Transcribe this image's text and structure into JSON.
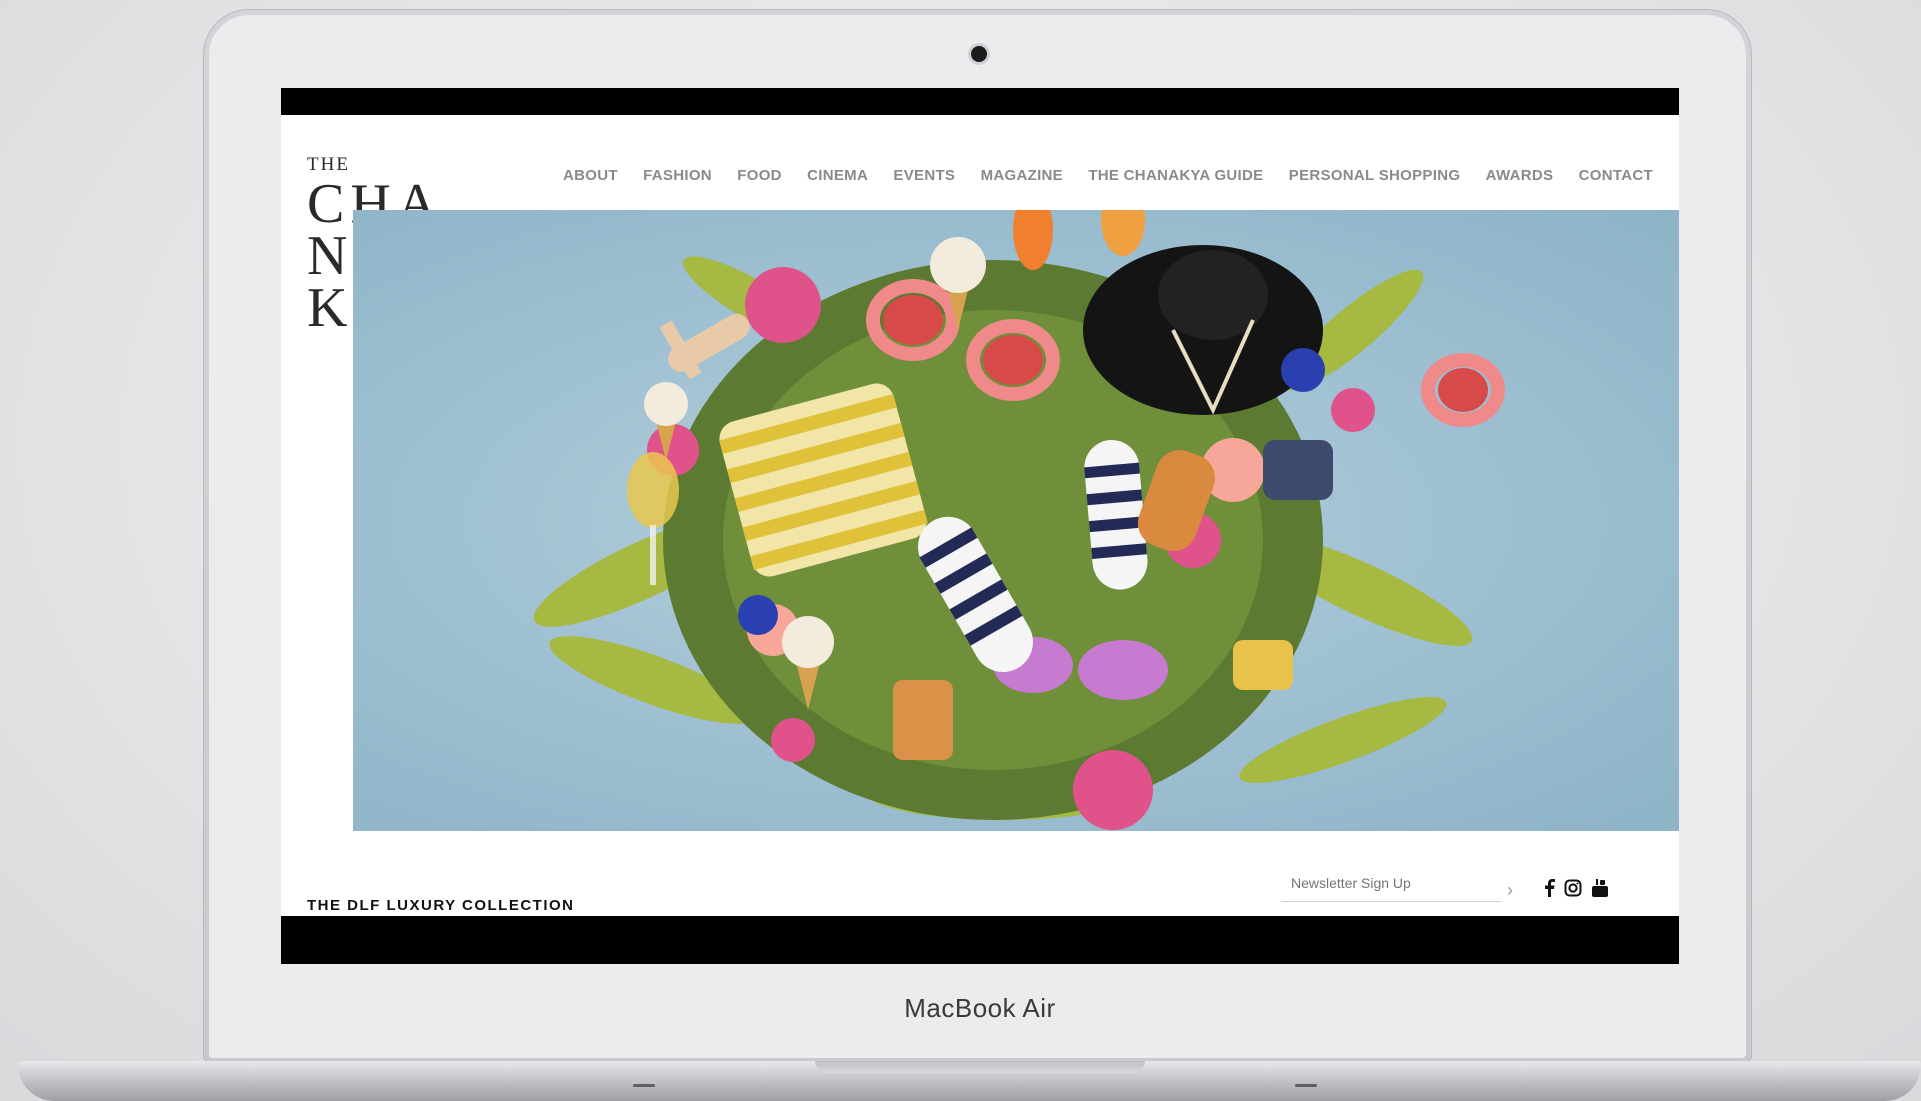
{
  "device": {
    "label": "MacBook Air"
  },
  "site": {
    "logo": {
      "the": "THE",
      "lines": [
        "CHA",
        "NA",
        "KYA"
      ]
    },
    "nav": [
      "ABOUT",
      "FASHION",
      "FOOD",
      "CINEMA",
      "EVENTS",
      "MAGAZINE",
      "THE CHANAKYA GUIDE",
      "PERSONAL SHOPPING",
      "AWARDS",
      "CONTACT"
    ],
    "footer": {
      "tagline": "THE DLF LUXURY COLLECTION",
      "newsletter_placeholder": "Newsletter Sign Up",
      "submit_icon": "chevron-right-icon",
      "social_icons": [
        "facebook-icon",
        "instagram-icon",
        "youtube-icon"
      ]
    }
  }
}
